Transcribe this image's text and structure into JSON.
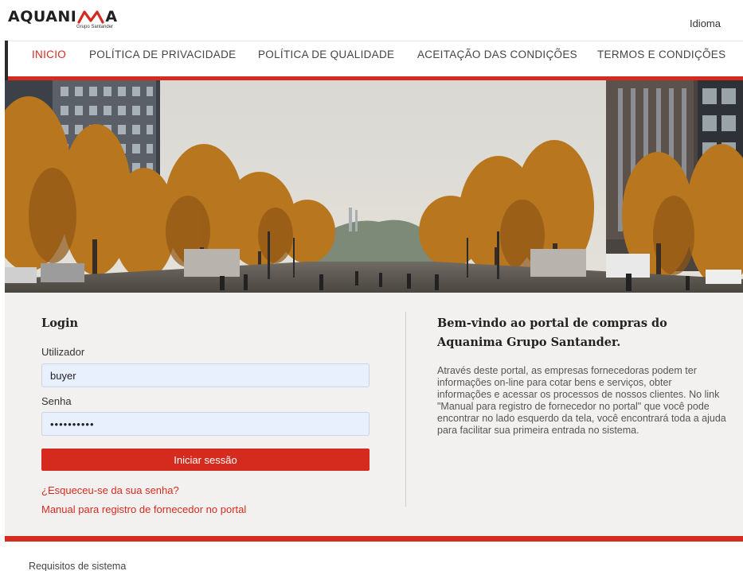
{
  "brand": {
    "name_left": "AQUANI",
    "name_right": "A",
    "subtitle": "Grupo Santander",
    "accent_color": "#d52b1e"
  },
  "header": {
    "language_label": "Idioma"
  },
  "nav": {
    "items": [
      {
        "label": "INICIO",
        "active": true
      },
      {
        "label": "POLÍTICA DE PRIVACIDADE",
        "active": false
      },
      {
        "label": "POLÍTICA DE QUALIDADE",
        "active": false
      },
      {
        "label": "ACEITAÇÃO DAS CONDIÇÕES",
        "active": false
      },
      {
        "label": "TERMOS E CONDIÇÕES",
        "active": false
      }
    ]
  },
  "login": {
    "title": "Login",
    "user_label": "Utilizador",
    "user_value": "buyer",
    "password_label": "Senha",
    "password_value": "••••••••••",
    "submit_label": "Iniciar sessão",
    "forgot_link": "¿Esqueceu-se da sua senha?",
    "manual_link": "Manual para registro de fornecedor no portal"
  },
  "welcome": {
    "title": "Bem-vindo ao portal de compras do Aquanima Grupo Santander.",
    "text": "Através deste portal, as empresas fornecedoras podem ter informações on-line para cotar bens e serviços, obter informações e acessar os processos de nossos clientes. No link \"Manual para registro de fornecedor no portal\" que você pode encontrar no lado esquerdo da tela, você encontrará toda a ajuda para facilitar sua primeira entrada no sistema."
  },
  "footer": {
    "system_requirements_link": "Requisitos de sistema"
  }
}
